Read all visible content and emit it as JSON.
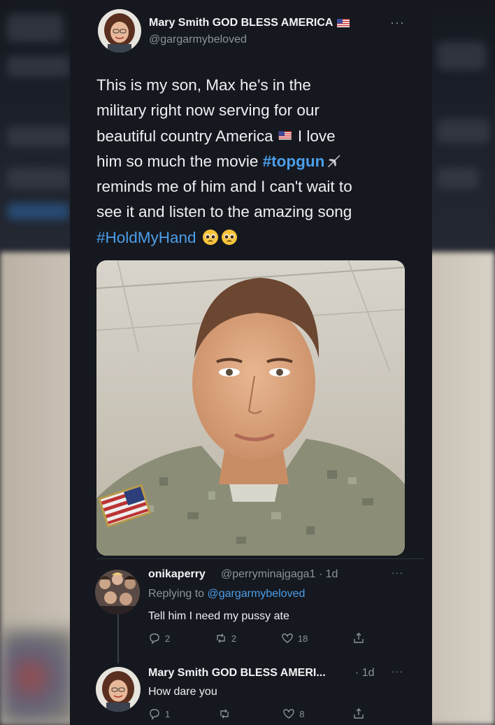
{
  "main_tweet": {
    "display_name": "Mary Smith GOD BLESS AMERICA",
    "handle": "@gargarmybeloved",
    "more_icon": "more-options-icon",
    "text_lines": [
      {
        "text": "This is my son, Max he's in the"
      },
      {
        "text": "military right now serving for our"
      },
      {
        "pre": "beautiful country America",
        "post": " I love"
      },
      {
        "pre": "him so much the movie ",
        "hashtag": "#topgun"
      },
      {
        "text": "reminds me of him and I can't wait to"
      },
      {
        "text": "see it and listen to the amazing song"
      },
      {
        "hashtag": "#HoldMyHand"
      }
    ],
    "image_alt": "soldier-portrait-photo"
  },
  "reply_1": {
    "display_name": "onikaperry",
    "handle_time": "@perryminajgaga1 · 1d",
    "replying_prefix": "Replying to ",
    "replying_to": "@gargarmybeloved",
    "text": "Tell him I need my pussy ate",
    "counts": {
      "replies": "2",
      "retweets": "2",
      "likes": "18"
    }
  },
  "reply_2": {
    "display_name": "Mary Smith GOD BLESS AMERI...",
    "time": "· 1d",
    "text": "How dare you",
    "counts": {
      "replies": "1",
      "retweets": "",
      "likes": "8"
    }
  },
  "colors": {
    "background": "#15181f",
    "text": "#eef0f2",
    "secondary": "#8b939c",
    "link": "#4c9ee9"
  }
}
